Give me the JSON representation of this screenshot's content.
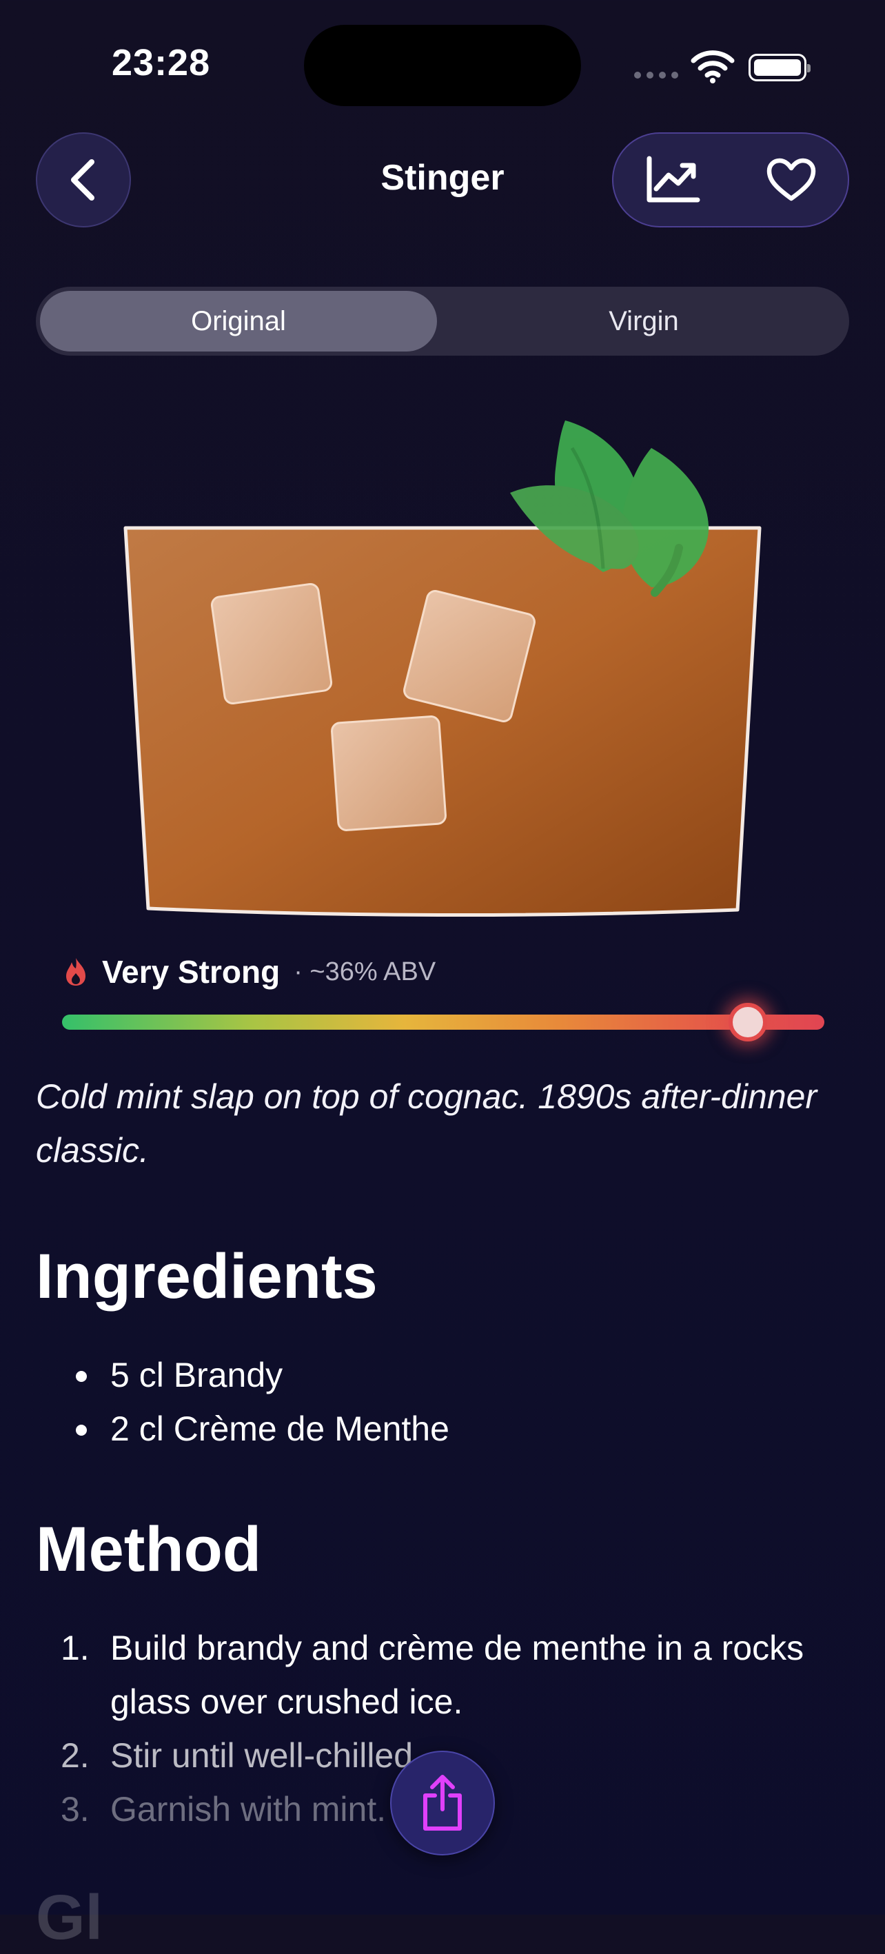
{
  "status_bar": {
    "time": "23:28"
  },
  "nav": {
    "title": "Stinger",
    "back_icon": "chevron-left-icon",
    "stats_icon": "chart-line-icon",
    "favorite_icon": "heart-icon"
  },
  "segments": {
    "selected": "Original",
    "options": [
      "Original",
      "Virgin"
    ]
  },
  "strength": {
    "label": "Very Strong",
    "abv": "· ~36% ABV",
    "level": 0.9,
    "colors": [
      "#35c06a",
      "#e6b53c",
      "#e14552"
    ]
  },
  "description": "Cold mint slap on top of cognac. 1890s after-dinner classic.",
  "ingredients": {
    "title": "Ingredients",
    "items": [
      "5 cl Brandy",
      "2 cl Crème de Menthe"
    ]
  },
  "method": {
    "title": "Method",
    "steps": [
      {
        "num": "1.",
        "text": "Build brandy and crème de menthe in a rocks glass over crushed ice."
      },
      {
        "num": "2.",
        "text": "Stir until well-chilled."
      },
      {
        "num": "3.",
        "text": "Garnish with mint."
      }
    ]
  },
  "next_section_peek": "Gl",
  "share": {
    "icon": "share-icon",
    "accent": "#e040fb"
  }
}
